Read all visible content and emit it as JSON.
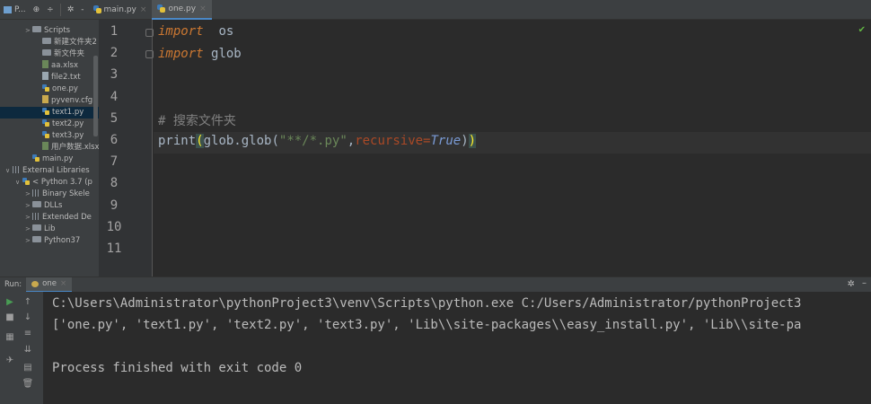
{
  "toolbar": {
    "project_label": "P...",
    "tabs": [
      {
        "label": "main.py",
        "active": false
      },
      {
        "label": "one.py",
        "active": true
      }
    ]
  },
  "tree": {
    "items": [
      {
        "label": "Scripts",
        "kind": "folder",
        "indent": 2,
        "arrow": ">"
      },
      {
        "label": "新建文件夹2",
        "kind": "folder",
        "indent": 3,
        "arrow": ""
      },
      {
        "label": "新文件夹",
        "kind": "folder",
        "indent": 3,
        "arrow": ""
      },
      {
        "label": "aa.xlsx",
        "kind": "xlsx",
        "indent": 3,
        "arrow": ""
      },
      {
        "label": "file2.txt",
        "kind": "txt",
        "indent": 3,
        "arrow": ""
      },
      {
        "label": "one.py",
        "kind": "py",
        "indent": 3,
        "arrow": ""
      },
      {
        "label": "pyvenv.cfg",
        "kind": "cfg",
        "indent": 3,
        "arrow": ""
      },
      {
        "label": "text1.py",
        "kind": "py",
        "indent": 3,
        "arrow": "",
        "selected": true
      },
      {
        "label": "text2.py",
        "kind": "py",
        "indent": 3,
        "arrow": ""
      },
      {
        "label": "text3.py",
        "kind": "py",
        "indent": 3,
        "arrow": ""
      },
      {
        "label": "用户数据.xlsx",
        "kind": "xlsx",
        "indent": 3,
        "arrow": ""
      },
      {
        "label": "main.py",
        "kind": "py",
        "indent": 2,
        "arrow": ""
      },
      {
        "label": "External Libraries",
        "kind": "lib",
        "indent": 0,
        "arrow": "v"
      },
      {
        "label": "< Python 3.7 (p",
        "kind": "python",
        "indent": 1,
        "arrow": "v"
      },
      {
        "label": "Binary Skele",
        "kind": "lib",
        "indent": 2,
        "arrow": ">"
      },
      {
        "label": "DLLs",
        "kind": "folder",
        "indent": 2,
        "arrow": ">"
      },
      {
        "label": "Extended De",
        "kind": "lib",
        "indent": 2,
        "arrow": ">"
      },
      {
        "label": "Lib",
        "kind": "folder",
        "indent": 2,
        "arrow": ">"
      },
      {
        "label": "Python37",
        "kind": "folder",
        "indent": 2,
        "arrow": ">"
      }
    ]
  },
  "editor": {
    "line_numbers": [
      "1",
      "2",
      "3",
      "4",
      "5",
      "6",
      "7",
      "8",
      "9",
      "10",
      "11"
    ],
    "line1": {
      "kw": "import",
      "mod": "os"
    },
    "line2": {
      "kw": "import",
      "mod": "glob"
    },
    "line5": {
      "comment": "# 搜索文件夹"
    },
    "line6": {
      "func": "print",
      "open": "(",
      "call": "glob.glob(",
      "arg_str": "\"**/*.py\"",
      "comma": ",",
      "kwarg": "recursive",
      "eq": "=",
      "true": "True",
      "close_inner": ")",
      "close": ")"
    }
  },
  "run": {
    "label": "Run:",
    "tab": "one",
    "output": [
      "C:\\Users\\Administrator\\pythonProject3\\venv\\Scripts\\python.exe C:/Users/Administrator/pythonProject3",
      "['one.py', 'text1.py', 'text2.py', 'text3.py', 'Lib\\\\site-packages\\\\easy_install.py', 'Lib\\\\site-pa",
      "",
      "Process finished with exit code 0"
    ]
  }
}
